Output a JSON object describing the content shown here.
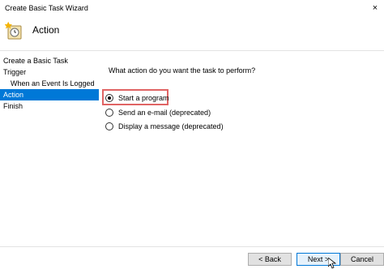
{
  "window": {
    "title": "Create Basic Task Wizard",
    "close_glyph": "×"
  },
  "header": {
    "heading": "Action",
    "icon": "task-clock-icon"
  },
  "sidebar": {
    "items": [
      {
        "label": "Create a Basic Task",
        "active": false,
        "indent": false
      },
      {
        "label": "Trigger",
        "active": false,
        "indent": false
      },
      {
        "label": "When an Event Is Logged",
        "active": false,
        "indent": true
      },
      {
        "label": "Action",
        "active": true,
        "indent": false
      },
      {
        "label": "Finish",
        "active": false,
        "indent": false
      }
    ]
  },
  "main": {
    "prompt": "What action do you want the task to perform?",
    "options": [
      {
        "label": "Start a program",
        "selected": true
      },
      {
        "label": "Send an e-mail (deprecated)",
        "selected": false
      },
      {
        "label": "Display a message (deprecated)",
        "selected": false
      }
    ]
  },
  "footer": {
    "back_label": "< Back",
    "next_label": "Next >",
    "cancel_label": "Cancel"
  },
  "colors": {
    "selection": "#0078d7",
    "highlight_box": "#e06464"
  }
}
